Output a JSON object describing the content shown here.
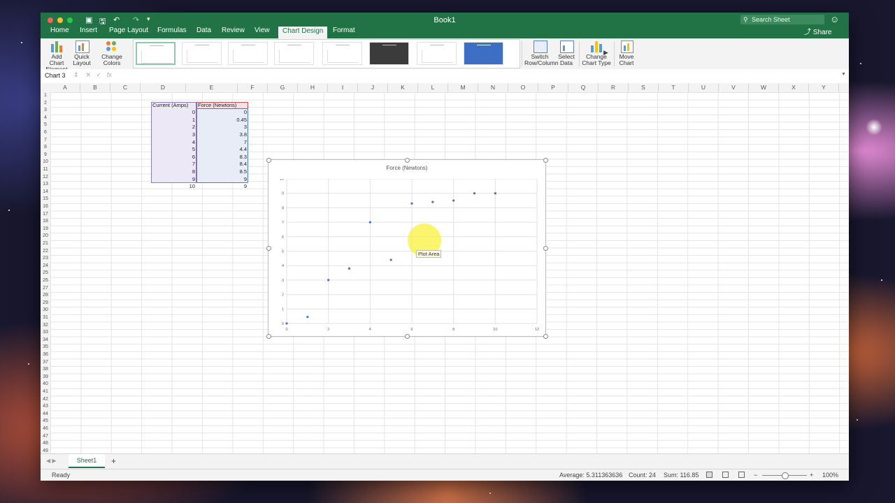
{
  "window": {
    "title": "Book1"
  },
  "search": {
    "placeholder": "Search Sheet"
  },
  "share_label": "Share",
  "tabs": [
    "Home",
    "Insert",
    "Page Layout",
    "Formulas",
    "Data",
    "Review",
    "View",
    "Chart Design",
    "Format"
  ],
  "active_tab": "Chart Design",
  "ribbon": {
    "add_chart_element": "Add Chart Element",
    "quick_layout": "Quick Layout",
    "change_colors": "Change Colors",
    "switch_row_column": "Switch Row/Column",
    "select_data": "Select Data",
    "change_chart_type": "Change Chart Type",
    "move_chart": "Move Chart"
  },
  "formula_bar": {
    "name_box": "Chart 3",
    "fx": "fx"
  },
  "columns": [
    "A",
    "B",
    "C",
    "D",
    "E",
    "F",
    "G",
    "H",
    "I",
    "J",
    "K",
    "L",
    "M",
    "N",
    "O",
    "P",
    "Q",
    "R",
    "S",
    "T",
    "U",
    "V",
    "W",
    "X",
    "Y"
  ],
  "rows": [
    "1",
    "2",
    "3",
    "4",
    "5",
    "6",
    "7",
    "8",
    "9",
    "10",
    "11",
    "12",
    "13",
    "14",
    "15",
    "16",
    "17",
    "18",
    "19",
    "20",
    "21",
    "22",
    "23",
    "24",
    "25",
    "26",
    "27",
    "28",
    "29",
    "30",
    "31",
    "32",
    "33",
    "34",
    "35",
    "36",
    "37",
    "38",
    "39",
    "40",
    "41",
    "42",
    "43",
    "44",
    "45",
    "46",
    "47",
    "48",
    "49"
  ],
  "table": {
    "header_d": "Current (Amps)",
    "header_e": "Force (Newtons)",
    "current": [
      "0",
      "1",
      "2",
      "3",
      "4",
      "5",
      "6",
      "7",
      "8",
      "9",
      "10"
    ],
    "force": [
      "0",
      "0.45",
      "3",
      "3.8",
      "7",
      "4.4",
      "8.3",
      "8.4",
      "8.5",
      "9",
      "9"
    ]
  },
  "chart_data": {
    "type": "scatter",
    "title": "Force (Newtons)",
    "x": [
      0,
      1,
      2,
      3,
      4,
      5,
      6,
      7,
      8,
      9,
      10
    ],
    "y": [
      0,
      0.45,
      3,
      3.8,
      7,
      4.4,
      8.3,
      8.4,
      8.5,
      9,
      9
    ],
    "xlim": [
      0,
      12
    ],
    "ylim": [
      0,
      10
    ],
    "xticks": [
      0,
      2,
      4,
      6,
      8,
      10,
      12
    ],
    "yticks": [
      0,
      1,
      2,
      3,
      4,
      5,
      6,
      7,
      8,
      9,
      10
    ],
    "grid": true,
    "marker_color": "#4472c4"
  },
  "tooltip": "Plot Area",
  "sheet_tab": "Sheet1",
  "status": {
    "ready": "Ready",
    "average": "Average: 5.311363636",
    "count": "Count: 24",
    "sum": "Sum: 116.85",
    "zoom": "100%",
    "zoom_minus": "−",
    "zoom_plus": "+"
  },
  "icons": {
    "search": "⚲",
    "smiley": "☺",
    "share": "⤴",
    "plus": "+"
  },
  "colors": {
    "excel_green": "#217346",
    "series_blue": "#4472c4"
  }
}
